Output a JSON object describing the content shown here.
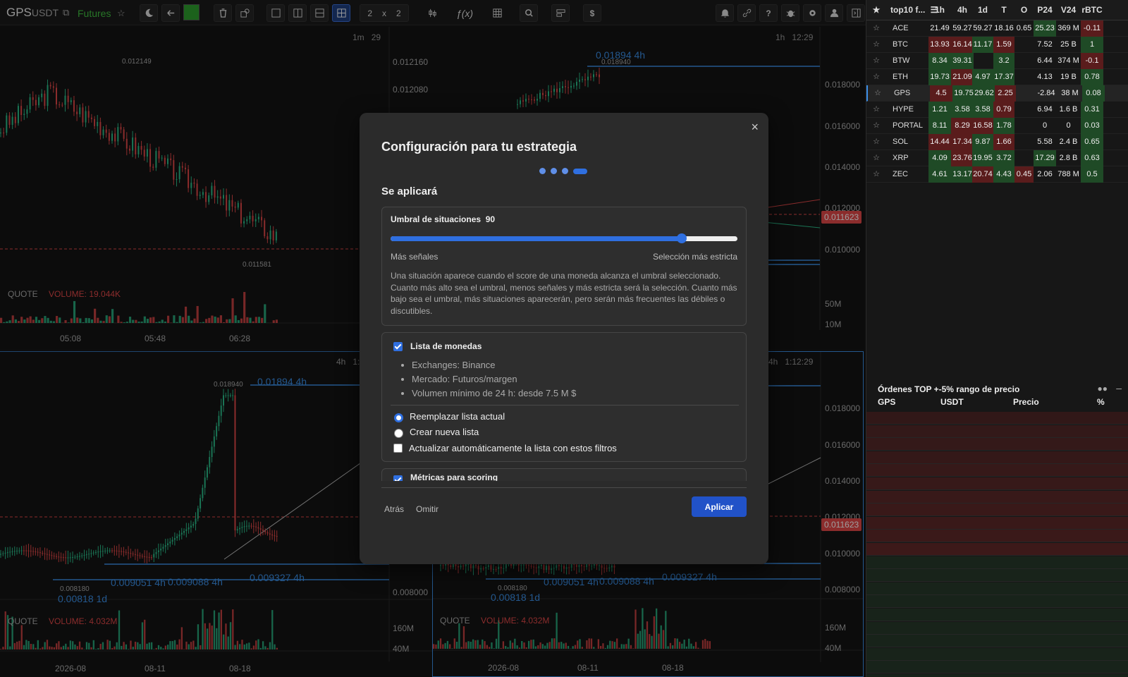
{
  "toolbar": {
    "symbol": "GPS",
    "quote": "USDT",
    "market": "Futures",
    "layout_rows": "2",
    "layout_x": "x",
    "layout_cols": "2",
    "dollar": "$"
  },
  "colors": {
    "accent": "#2f6fe0",
    "green": "#2bbd8a",
    "red": "#e04848",
    "line_blue": "#3a8ee6"
  },
  "charts": {
    "tl": {
      "timeframe": "1m",
      "countdown": "29",
      "high_label": "0.012149",
      "low_label": "0.011581",
      "quote_label": "QUOTE",
      "volume_label": "VOLUME: 19.044K",
      "axis": [
        "0.012160",
        "0.012080"
      ],
      "vol_axis": [
        "50M",
        "10M"
      ],
      "times": [
        "05:08",
        "05:48",
        "06:28"
      ]
    },
    "tr": {
      "timeframe": "1h",
      "countdown": "12:29",
      "mark": "0.01894  4h",
      "high_label": "0.018940",
      "price_tag": "0.011623",
      "axis": [
        "0.018000",
        "0.016000",
        "0.014000",
        "0.012000",
        "0.010000"
      ],
      "vol_axis": [
        "50M",
        "10M"
      ]
    },
    "bl": {
      "timeframe": "4h",
      "countdown": "1:",
      "high_label": "0.018940",
      "low_label": "0.008180",
      "mark_high": "0.01894  4h",
      "mark_a": "0.009051  4h",
      "mark_b": "0.009088  4h",
      "mark_c": "0.009327  4h",
      "mark_d": "0.00818  1d",
      "quote_label": "QUOTE",
      "volume_label": "VOLUME: 4.032M",
      "axis": [
        "0.008000"
      ],
      "vol_axis": [
        "160M",
        "40M"
      ],
      "times": [
        "2026-08",
        "08-11",
        "08-18"
      ]
    },
    "br": {
      "timeframe": "4h",
      "countdown": "1:12:29",
      "mark_a": "0.009051  4h",
      "mark_b": "0.009088  4h",
      "mark_c": "0.009327  4h",
      "mark_d": "0.00818  1d",
      "low_label": "0.008180",
      "price_tag": "0.011623",
      "quote_label": "QUOTE",
      "volume_label": "VOLUME: 4.032M",
      "axis": [
        "0.018000",
        "0.016000",
        "0.014000",
        "0.012000",
        "0.010000",
        "0.008000"
      ],
      "vol_axis": [
        "160M",
        "40M"
      ],
      "times": [
        "2026-08",
        "08-11",
        "08-18"
      ]
    }
  },
  "table": {
    "list_name": "top10 f...",
    "headers": [
      "1h",
      "4h",
      "1d",
      "T",
      "O",
      "P24",
      "V24",
      "rBTC"
    ],
    "rows": [
      {
        "sym": "ACE",
        "v": [
          "21.49",
          "59.27",
          "59.27",
          "18.16",
          "0.65",
          "25.23",
          "369 M",
          "-0.11"
        ],
        "c": [
          "",
          "",
          "",
          "",
          "",
          "g",
          "",
          "r"
        ]
      },
      {
        "sym": "BTC",
        "v": [
          "13.93",
          "16.14",
          "11.17",
          "1.59",
          "",
          "7.52",
          "25 B",
          "1"
        ],
        "c": [
          "r",
          "r",
          "g",
          "r",
          "",
          "",
          "",
          "g"
        ]
      },
      {
        "sym": "BTW",
        "v": [
          "8.34",
          "39.31",
          "",
          "3.2",
          "",
          "6.44",
          "374 M",
          "-0.1"
        ],
        "c": [
          "g",
          "g",
          "",
          "g",
          "",
          "",
          "",
          "r"
        ]
      },
      {
        "sym": "ETH",
        "v": [
          "19.73",
          "21.09",
          "4.97",
          "17.37",
          "",
          "4.13",
          "19 B",
          "0.78"
        ],
        "c": [
          "g",
          "r",
          "g",
          "g",
          "",
          "",
          "",
          "g"
        ]
      },
      {
        "sym": "GPS",
        "v": [
          "4.5",
          "19.75",
          "29.62",
          "2.25",
          "",
          "-2.84",
          "38 M",
          "0.08"
        ],
        "c": [
          "r",
          "g",
          "g",
          "r",
          "",
          "",
          "",
          "g"
        ]
      },
      {
        "sym": "HYPE",
        "v": [
          "1.21",
          "3.58",
          "3.58",
          "0.79",
          "",
          "6.94",
          "1.6 B",
          "0.31"
        ],
        "c": [
          "g",
          "g",
          "g",
          "r",
          "",
          "",
          "",
          "g"
        ]
      },
      {
        "sym": "PORTAL",
        "v": [
          "8.11",
          "8.29",
          "16.58",
          "1.78",
          "",
          "0",
          "0",
          "0.03"
        ],
        "c": [
          "g",
          "r",
          "r",
          "g",
          "",
          "",
          "",
          "g"
        ]
      },
      {
        "sym": "SOL",
        "v": [
          "14.44",
          "17.34",
          "9.87",
          "1.66",
          "",
          "5.58",
          "2.4 B",
          "0.65"
        ],
        "c": [
          "r",
          "r",
          "g",
          "r",
          "",
          "",
          "",
          "g"
        ]
      },
      {
        "sym": "XRP",
        "v": [
          "4.09",
          "23.76",
          "19.95",
          "3.72",
          "",
          "17.29",
          "2.8 B",
          "0.63"
        ],
        "c": [
          "g",
          "r",
          "g",
          "g",
          "",
          "g",
          "",
          "g"
        ]
      },
      {
        "sym": "ZEC",
        "v": [
          "4.61",
          "13.17",
          "20.74",
          "4.43",
          "0.45",
          "2.06",
          "788 M",
          "0.5"
        ],
        "c": [
          "g",
          "g",
          "r",
          "g",
          "r",
          "",
          "",
          "g"
        ]
      }
    ]
  },
  "orders": {
    "title": "Órdenes TOP +-5% rango de precio",
    "cols": [
      "GPS",
      "USDT",
      "Precio",
      "%"
    ]
  },
  "modal": {
    "title": "Configuración para tu estrategia",
    "subtitle": "Se aplicará",
    "threshold_label": "Umbral de situaciones",
    "threshold_value": "90",
    "threshold_fraction": 0.84,
    "slider_left": "Más señales",
    "slider_right": "Selección más estricta",
    "description": "Una situación aparece cuando el score de una moneda alcanza el umbral seleccionado. Cuanto más alto sea el umbral, menos señales y más estricta será la selección. Cuanto más bajo sea el umbral, más situaciones aparecerán, pero serán más frecuentes las débiles o discutibles.",
    "coins_title": "Lista de monedas",
    "bullets": [
      "Exchanges: Binance",
      "Mercado: Futuros/margen",
      "Volumen mínimo de 24 h: desde 7.5 M $"
    ],
    "opt_replace": "Reemplazar lista actual",
    "opt_new": "Crear nueva lista",
    "opt_auto": "Actualizar automáticamente la lista con estos filtros",
    "metrics_title": "Métricas para scoring",
    "back": "Atrás",
    "skip": "Omitir",
    "apply": "Aplicar",
    "close": "×"
  }
}
